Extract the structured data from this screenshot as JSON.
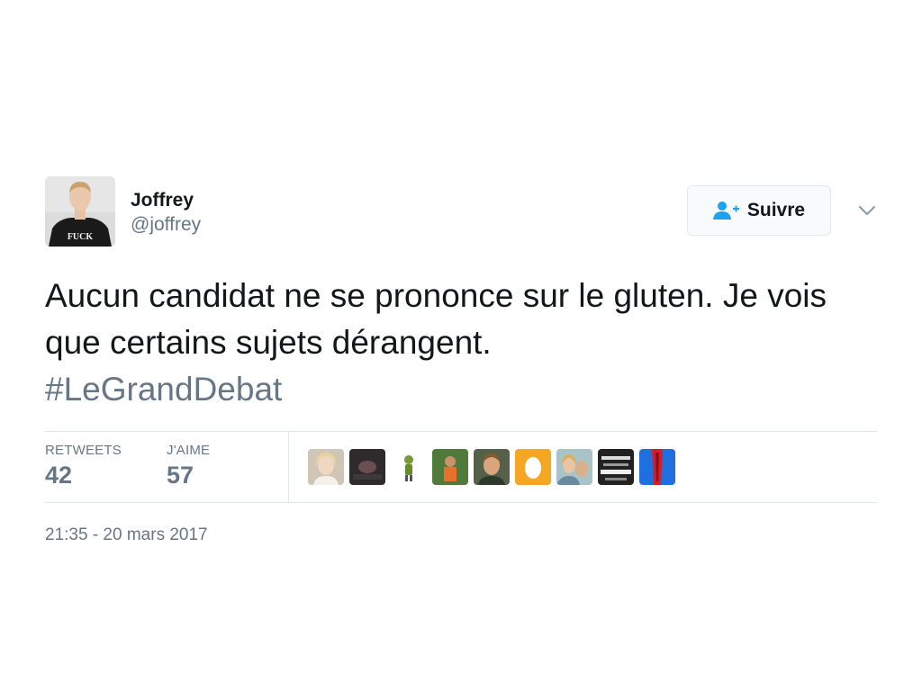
{
  "author": {
    "display_name": "Joffrey",
    "handle": "@joffrey",
    "avatar_shirt_text": "FUCK"
  },
  "follow_button": {
    "label": "Suivre"
  },
  "tweet": {
    "text": "Aucun candidat ne se prononce sur le gluten. Je vois que certains sujets dérangent.",
    "hashtag": "#LeGrandDebat"
  },
  "stats": {
    "retweets_label": "RETWEETS",
    "retweets_count": "42",
    "likes_label": "J'AIME",
    "likes_count": "57"
  },
  "likers": [
    {
      "name": "liker-avatar-1"
    },
    {
      "name": "liker-avatar-2"
    },
    {
      "name": "liker-avatar-3"
    },
    {
      "name": "liker-avatar-4"
    },
    {
      "name": "liker-avatar-5"
    },
    {
      "name": "liker-avatar-6"
    },
    {
      "name": "liker-avatar-7"
    },
    {
      "name": "liker-avatar-8"
    },
    {
      "name": "liker-avatar-9"
    }
  ],
  "timestamp": "21:35 - 20 mars 2017",
  "colors": {
    "text": "#14171a",
    "secondary": "#657786",
    "accent": "#1da1f2",
    "border": "#e1e8ed"
  }
}
